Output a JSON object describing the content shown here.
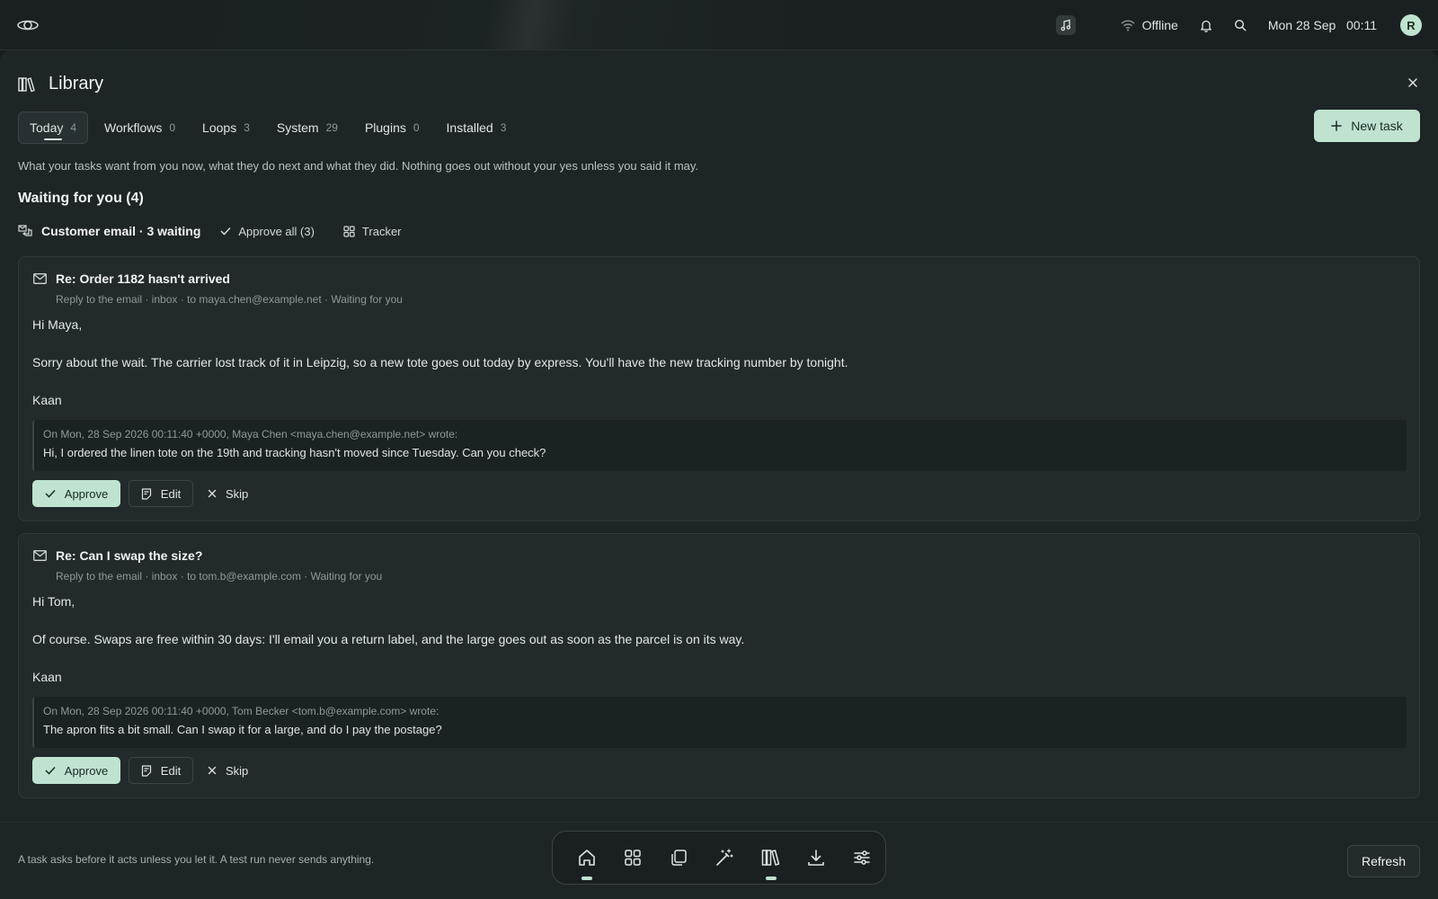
{
  "topbar": {
    "logo_icon": "orbit-logo-icon",
    "music_icon": "music-note-icon",
    "status_icon": "wifi-icon",
    "status_text": "Offline",
    "bell_icon": "bell-icon",
    "search_icon": "search-icon",
    "clock": "Mon 28 Sep   00:11",
    "avatar_initial": "R"
  },
  "panel": {
    "title": "Library",
    "title_icon": "library-books-icon",
    "close_icon": "close-icon",
    "tabs": [
      {
        "label": "Today",
        "count": "4",
        "active": true
      },
      {
        "label": "Workflows",
        "count": "0"
      },
      {
        "label": "Loops",
        "count": "3"
      },
      {
        "label": "System",
        "count": "29"
      },
      {
        "label": "Plugins",
        "count": "0"
      },
      {
        "label": "Installed",
        "count": "3"
      }
    ],
    "new_task_label": "New task",
    "intro": "What your tasks want from you now, what they do next and what they did. Nothing goes out without your yes unless you said it may.",
    "section_title": "Waiting for you (4)",
    "group": {
      "title": "Customer email · 3 waiting",
      "approve_all": "Approve all (3)",
      "tracker": "Tracker"
    }
  },
  "cards": [
    {
      "subject": "Re: Order 1182 hasn't arrived",
      "meta": "Reply to the email · inbox · to maya.chen@example.net · Waiting for you",
      "greeting": "Hi Maya,",
      "body": "Sorry about the wait. The carrier lost track of it in Leipzig, so a new tote goes out today by express. You'll have the new tracking number by tonight.",
      "signature": "Kaan",
      "quote_header": "On Mon, 28 Sep 2026 00:11:40 +0000, Maya Chen <maya.chen@example.net> wrote:",
      "quote_text": "Hi, I ordered the linen tote on the 19th and tracking hasn't moved since Tuesday. Can you check?",
      "approve": "Approve",
      "edit": "Edit",
      "skip": "Skip"
    },
    {
      "subject": "Re: Can I swap the size?",
      "meta": "Reply to the email · inbox · to tom.b@example.com · Waiting for you",
      "greeting": "Hi Tom,",
      "body": "Of course. Swaps are free within 30 days: I'll email you a return label, and the large goes out as soon as the parcel is on its way.",
      "signature": "Kaan",
      "quote_header": "On Mon, 28 Sep 2026 00:11:40 +0000, Tom Becker <tom.b@example.com> wrote:",
      "quote_text": "The apron fits a bit small. Can I swap it for a large, and do I pay the postage?",
      "approve": "Approve",
      "edit": "Edit",
      "skip": "Skip"
    }
  ],
  "footer": {
    "note": "A task asks before it acts unless you let it. A test run never sends anything.",
    "refresh": "Refresh"
  },
  "dock": [
    {
      "icon": "home-icon",
      "active": true
    },
    {
      "icon": "apps-grid-icon"
    },
    {
      "icon": "copy-windows-icon"
    },
    {
      "icon": "magic-wand-icon"
    },
    {
      "icon": "library-books-icon",
      "active": true
    },
    {
      "icon": "download-icon"
    },
    {
      "icon": "sliders-icon"
    }
  ],
  "colors": {
    "accent": "#bfe3d0",
    "background": "#171c1e",
    "panel": "#1e2527",
    "card": "#222a2c"
  }
}
